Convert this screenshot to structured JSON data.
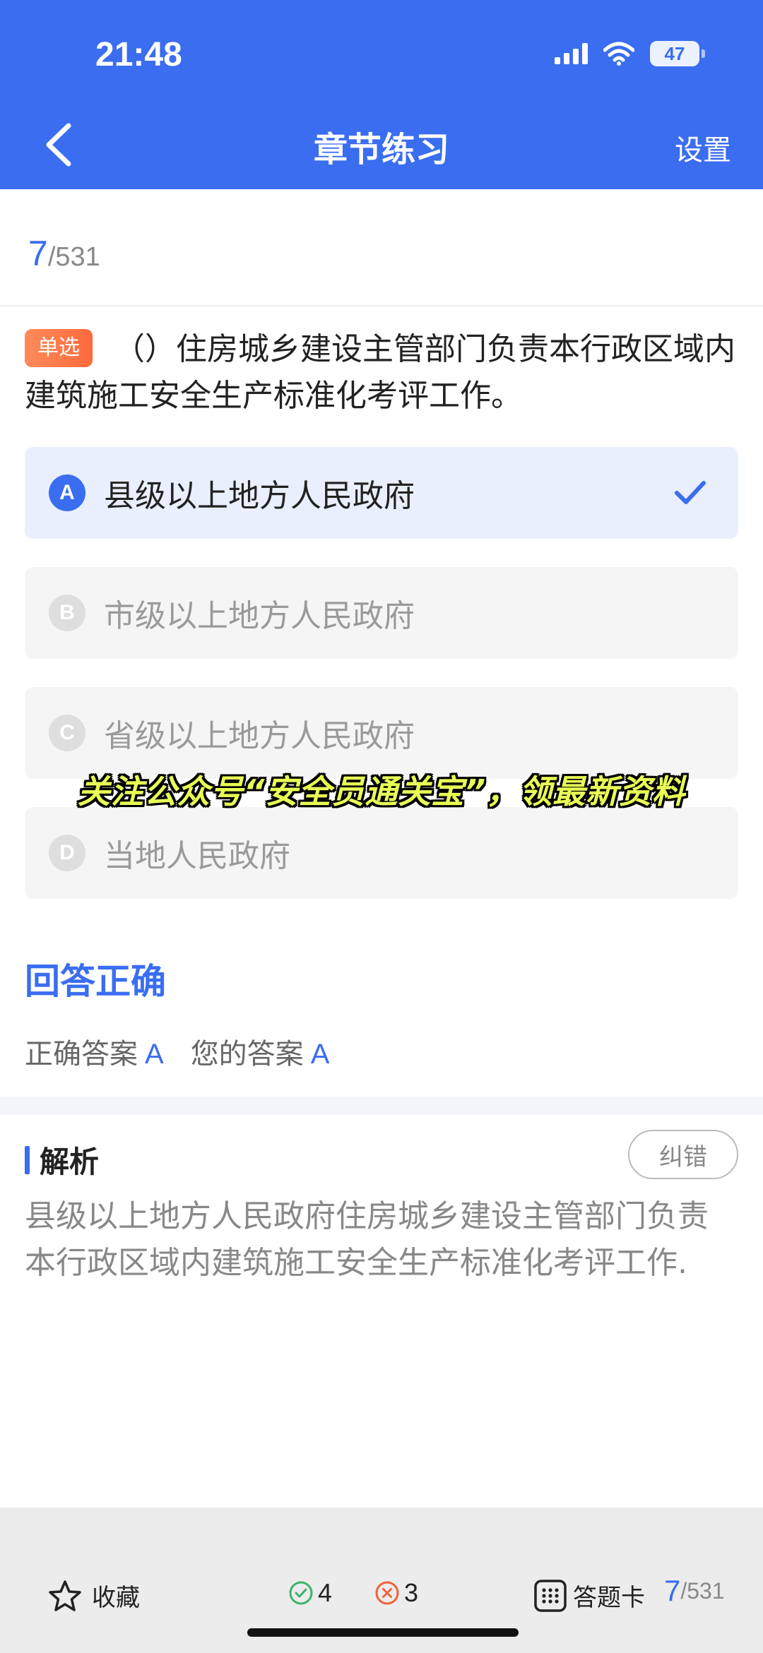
{
  "status_bar": {
    "time": "21:48",
    "battery": "47"
  },
  "nav": {
    "title": "章节练习",
    "settings_label": "设置"
  },
  "progress": {
    "current": "7",
    "total": "/531"
  },
  "question": {
    "type_tag": "单选",
    "text": "（）住房城乡建设主管部门负责本行政区域内建筑施工安全生产标准化考评工作。"
  },
  "options": [
    {
      "letter": "A",
      "text": "县级以上地方人民政府",
      "state": "correct"
    },
    {
      "letter": "B",
      "text": "市级以上地方人民政府",
      "state": "normal"
    },
    {
      "letter": "C",
      "text": "省级以上地方人民政府",
      "state": "normal"
    },
    {
      "letter": "D",
      "text": "当地人民政府",
      "state": "normal"
    }
  ],
  "overlay": {
    "text": "关注公众号“安全员通关宝”，领最新资料"
  },
  "result": {
    "title": "回答正确",
    "correct_label": "正确答案",
    "correct_value": "A",
    "your_label": "您的答案",
    "your_value": "A"
  },
  "analysis": {
    "title": "解析",
    "report_label": "纠错",
    "text": "县级以上地方人民政府住房城乡建设主管部门负责本行政区域内建筑施工安全生产标准化考评工作."
  },
  "bottom_bar": {
    "collect_label": "收藏",
    "right_count": "4",
    "wrong_count": "3",
    "card_label": "答题卡",
    "progress_current": "7",
    "progress_total": "/531"
  },
  "colors": {
    "accent": "#3a6df0",
    "tag": "#ff6a3c",
    "right": "#3bb36a",
    "wrong": "#f0623c"
  },
  "icons": [
    "back-icon",
    "signal-icon",
    "wifi-icon",
    "battery-icon",
    "check-icon",
    "star-icon",
    "right-circle-icon",
    "wrong-circle-icon",
    "grid-icon"
  ]
}
